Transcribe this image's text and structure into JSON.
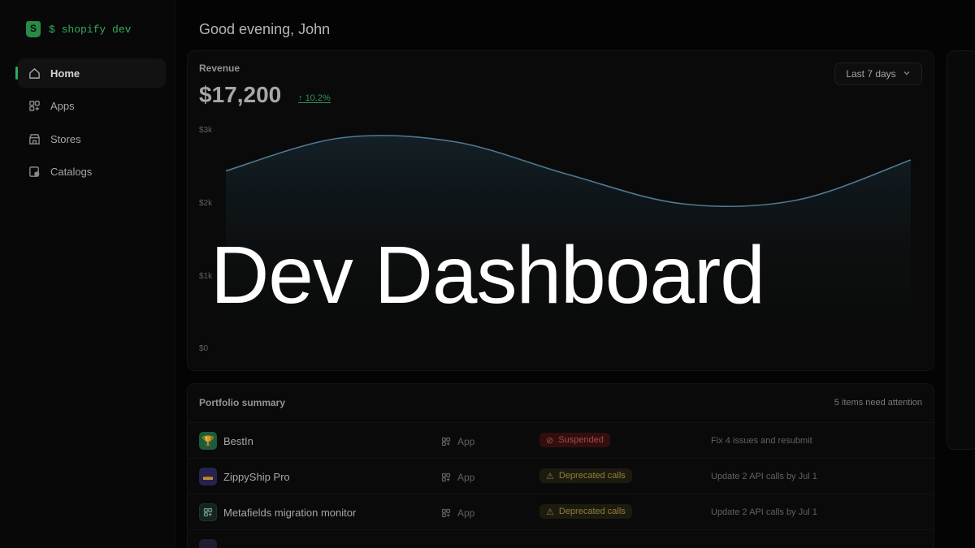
{
  "brand": {
    "name": "$ shopify dev"
  },
  "sidebar": {
    "items": [
      {
        "label": "Home",
        "icon": "home-icon",
        "active": true
      },
      {
        "label": "Apps",
        "icon": "apps-icon",
        "active": false
      },
      {
        "label": "Stores",
        "icon": "store-icon",
        "active": false
      },
      {
        "label": "Catalogs",
        "icon": "catalog-icon",
        "active": false
      }
    ]
  },
  "header": {
    "greeting": "Good evening, John"
  },
  "revenue": {
    "label": "Revenue",
    "value": "$17,200",
    "change": "10.2%",
    "range": "Last 7 days",
    "y_ticks": [
      "$3k",
      "$2k",
      "$1k",
      "$0"
    ]
  },
  "chart_data": {
    "type": "area",
    "title": "Revenue",
    "x": [
      1,
      2,
      3,
      4,
      5,
      6,
      7
    ],
    "values": [
      2450,
      2900,
      2850,
      2400,
      2000,
      2050,
      2600
    ],
    "ylim": [
      0,
      3000
    ],
    "y_ticks": [
      "$3k",
      "$2k",
      "$1k",
      "$0"
    ],
    "grid": false,
    "color": "#5a8aa8"
  },
  "portfolio": {
    "title": "Portfolio summary",
    "attention": "5 items need attention",
    "rows": [
      {
        "name": "BestIn",
        "type": "App",
        "status": "Suspended",
        "status_kind": "error",
        "action": "Fix 4 issues and resubmit",
        "icon": "trophy-icon"
      },
      {
        "name": "ZippyShip Pro",
        "type": "App",
        "status": "Deprecated calls",
        "status_kind": "warning",
        "action": "Update 2 API calls by Jul 1",
        "icon": "box-icon"
      },
      {
        "name": "Metafields migration monitor",
        "type": "App",
        "status": "Deprecated calls",
        "status_kind": "warning",
        "action": "Update 2 API calls by Jul 1",
        "icon": "grid-icon"
      }
    ]
  },
  "hero": {
    "title": "Dev Dashboard"
  },
  "colors": {
    "accent": "#35c46a",
    "error": "#c0504d",
    "warning": "#a5903f",
    "chart_line": "#5a8aa8"
  }
}
